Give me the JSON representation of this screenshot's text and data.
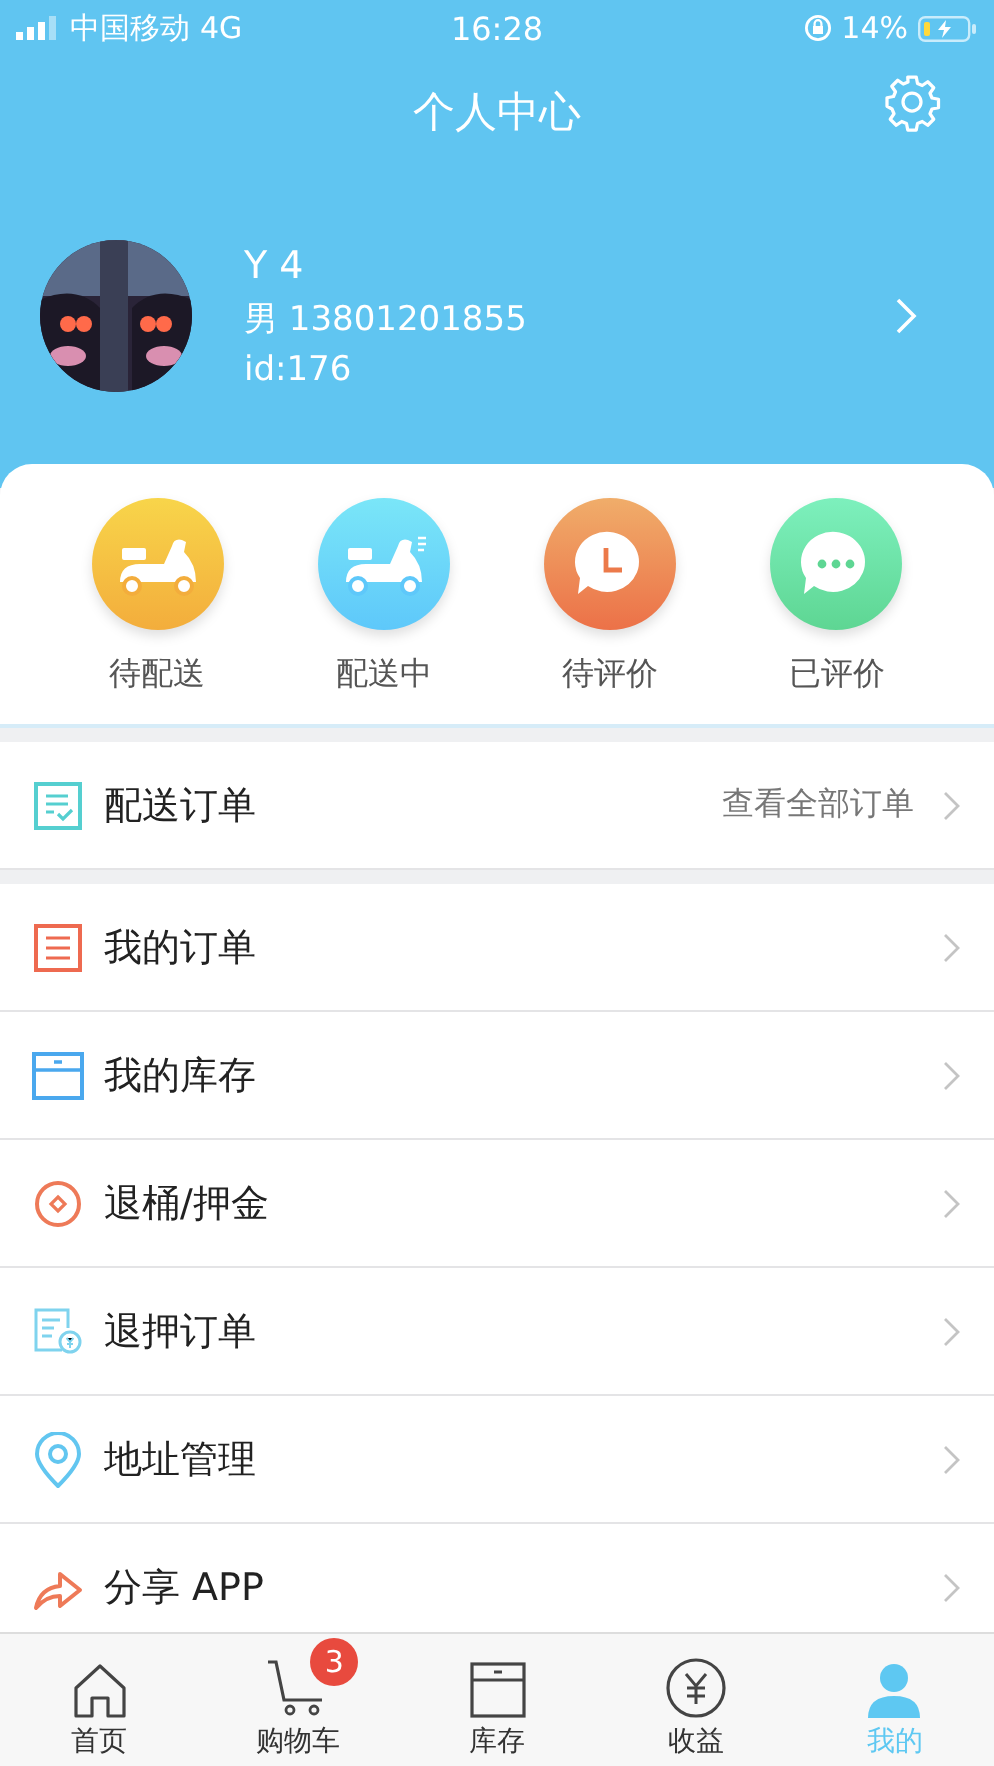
{
  "status_bar": {
    "carrier": "中国移动",
    "network": "4G",
    "time": "16:28",
    "battery": "14%"
  },
  "header": {
    "title": "个人中心"
  },
  "profile": {
    "name": "Y 4",
    "phone": "男 13801201855",
    "id": "id:176"
  },
  "order_status": [
    {
      "label": "待配送"
    },
    {
      "label": "配送中"
    },
    {
      "label": "待评价"
    },
    {
      "label": "已评价"
    }
  ],
  "delivery_orders": {
    "label": "配送订单",
    "link": "查看全部订单"
  },
  "menu": [
    {
      "label": "我的订单"
    },
    {
      "label": "我的库存"
    },
    {
      "label": "退桶/押金"
    },
    {
      "label": "退押订单"
    },
    {
      "label": "地址管理"
    },
    {
      "label": "分享 APP"
    }
  ],
  "tab_bar": [
    {
      "label": "首页",
      "selected": false
    },
    {
      "label": "购物车",
      "selected": false,
      "badge": "3"
    },
    {
      "label": "库存",
      "selected": false
    },
    {
      "label": "收益",
      "selected": false
    },
    {
      "label": "我的",
      "selected": true
    }
  ]
}
